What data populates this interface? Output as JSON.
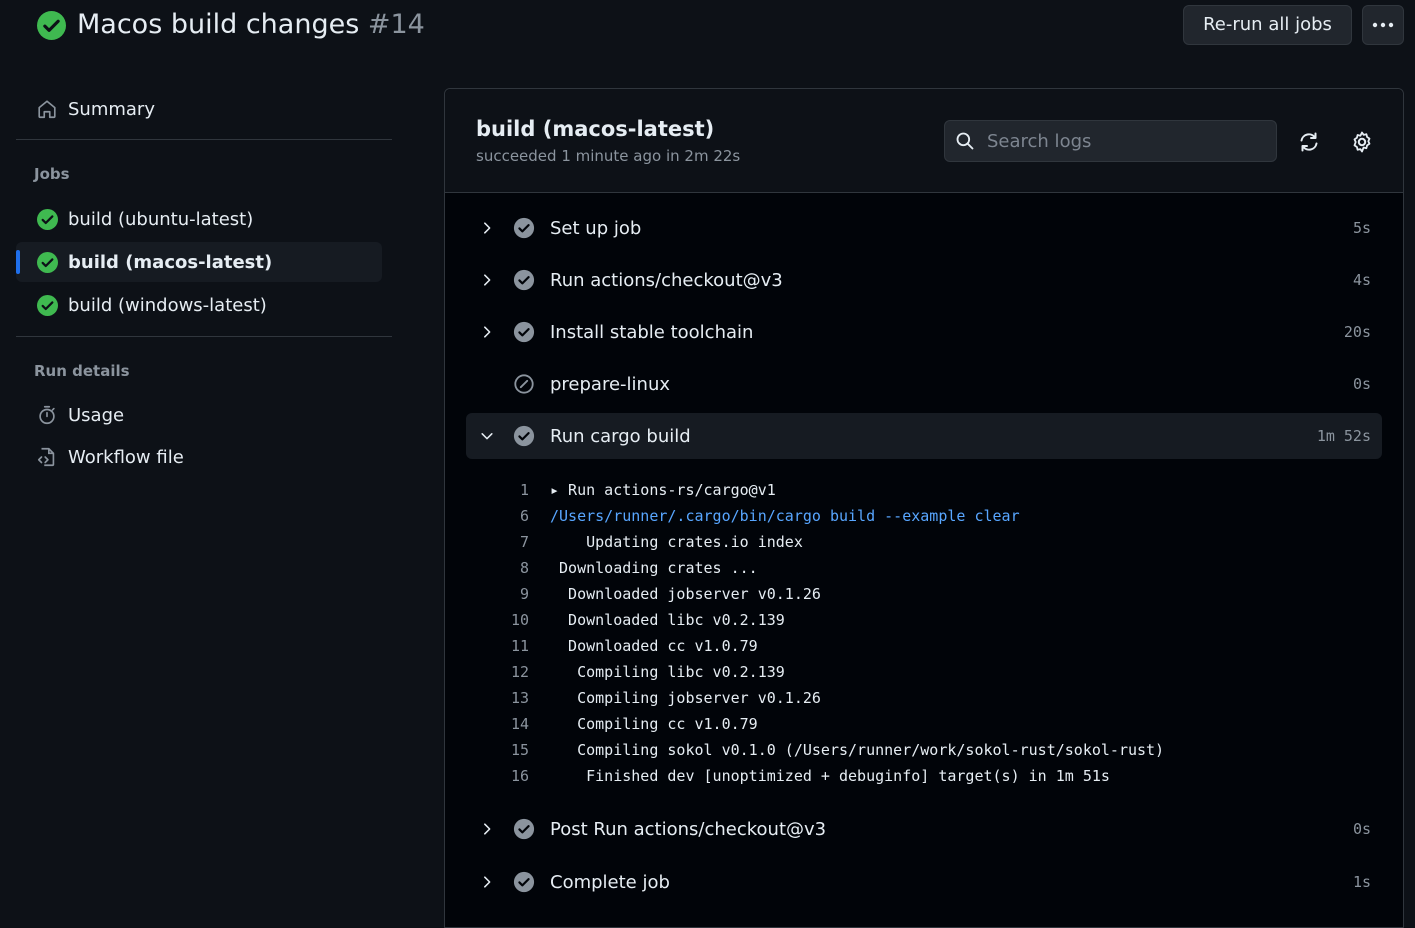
{
  "header": {
    "title": "Macos build changes",
    "run_number": "#14",
    "rerun_label": "Re-run all jobs",
    "more_icon": "kebab-horizontal-icon"
  },
  "sidebar": {
    "summary_label": "Summary",
    "jobs_heading": "Jobs",
    "jobs": [
      {
        "label": "build (ubuntu-latest)",
        "status": "success"
      },
      {
        "label": "build (macos-latest)",
        "status": "success",
        "active": true
      },
      {
        "label": "build (windows-latest)",
        "status": "success"
      }
    ],
    "run_details_heading": "Run details",
    "usage_label": "Usage",
    "workflow_file_label": "Workflow file"
  },
  "job": {
    "title": "build (macos-latest)",
    "subtitle": "succeeded 1 minute ago in 2m 22s",
    "search_placeholder": "Search logs"
  },
  "steps": [
    {
      "name": "Set up job",
      "duration": "5s",
      "status": "success"
    },
    {
      "name": "Run actions/checkout@v3",
      "duration": "4s",
      "status": "success"
    },
    {
      "name": "Install stable toolchain",
      "duration": "20s",
      "status": "success"
    },
    {
      "name": "prepare-linux",
      "duration": "0s",
      "status": "skipped"
    },
    {
      "name": "Run cargo build",
      "duration": "1m 52s",
      "status": "success",
      "expanded": true
    },
    {
      "name": "Post Run actions/checkout@v3",
      "duration": "0s",
      "status": "success"
    },
    {
      "name": "Complete job",
      "duration": "1s",
      "status": "success"
    }
  ],
  "log_lines": [
    {
      "n": "1",
      "text": "▸ Run actions-rs/cargo@v1"
    },
    {
      "n": "6",
      "text": "/Users/runner/.cargo/bin/cargo build --example clear",
      "cmd": true
    },
    {
      "n": "7",
      "text": "    Updating crates.io index"
    },
    {
      "n": "8",
      "text": " Downloading crates ..."
    },
    {
      "n": "9",
      "text": "  Downloaded jobserver v0.1.26"
    },
    {
      "n": "10",
      "text": "  Downloaded libc v0.2.139"
    },
    {
      "n": "11",
      "text": "  Downloaded cc v1.0.79"
    },
    {
      "n": "12",
      "text": "   Compiling libc v0.2.139"
    },
    {
      "n": "13",
      "text": "   Compiling jobserver v0.1.26"
    },
    {
      "n": "14",
      "text": "   Compiling cc v1.0.79"
    },
    {
      "n": "15",
      "text": "   Compiling sokol v0.1.0 (/Users/runner/work/sokol-rust/sokol-rust)"
    },
    {
      "n": "16",
      "text": "    Finished dev [unoptimized + debuginfo] target(s) in 1m 51s"
    }
  ],
  "colors": {
    "success": "#3fb950",
    "step_success": "#8b949e",
    "accent": "#1f6feb",
    "command": "#58a6ff"
  }
}
